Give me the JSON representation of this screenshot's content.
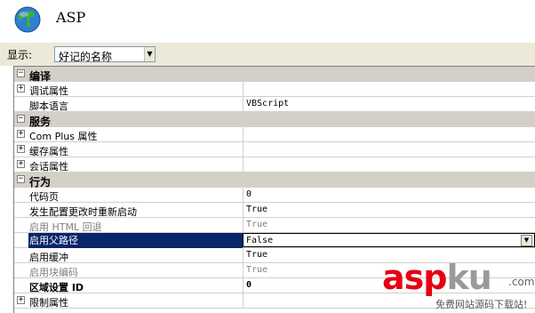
{
  "header": {
    "title": "ASP",
    "icon": "globe-icon"
  },
  "display": {
    "label": "显示:",
    "selected": "好记的名称"
  },
  "properties": [
    {
      "type": "category",
      "toggle": "⊟",
      "name": "编译"
    },
    {
      "type": "prop",
      "toggle": "⊞",
      "name": "调试属性",
      "value": ""
    },
    {
      "type": "prop",
      "toggle": "",
      "name": "脚本语言",
      "value": "VBScript"
    },
    {
      "type": "category",
      "toggle": "⊟",
      "name": "服务"
    },
    {
      "type": "prop",
      "toggle": "⊞",
      "name": "Com Plus 属性",
      "value": ""
    },
    {
      "type": "prop",
      "toggle": "⊞",
      "name": "缓存属性",
      "value": ""
    },
    {
      "type": "prop",
      "toggle": "⊞",
      "name": "会话属性",
      "value": ""
    },
    {
      "type": "category",
      "toggle": "⊟",
      "name": "行为"
    },
    {
      "type": "prop",
      "toggle": "",
      "name": "代码页",
      "value": "0"
    },
    {
      "type": "prop",
      "toggle": "",
      "name": "发生配置更改时重新启动",
      "value": "True"
    },
    {
      "type": "prop",
      "toggle": "",
      "name": "启用 HTML 回退",
      "value": "True",
      "disabled": true
    },
    {
      "type": "prop",
      "toggle": "",
      "name": "启用父路径",
      "value": "False",
      "selected": true
    },
    {
      "type": "prop",
      "toggle": "",
      "name": "启用缓冲",
      "value": "True"
    },
    {
      "type": "prop",
      "toggle": "",
      "name": "启用块编码",
      "value": "True",
      "disabled": true
    },
    {
      "type": "prop",
      "toggle": "",
      "name": "区域设置 ID",
      "value": "0",
      "bold": true
    },
    {
      "type": "prop",
      "toggle": "⊞",
      "name": "限制属性",
      "value": ""
    }
  ],
  "watermark": {
    "main_a": "asp",
    "main_b": "ku",
    "dotcom": ".com",
    "sub": "免费网站源码下载站!"
  },
  "colors": {
    "selection": "#0a246a",
    "category_bg": "#d4d0c8",
    "watermark_red": "#e60012"
  }
}
